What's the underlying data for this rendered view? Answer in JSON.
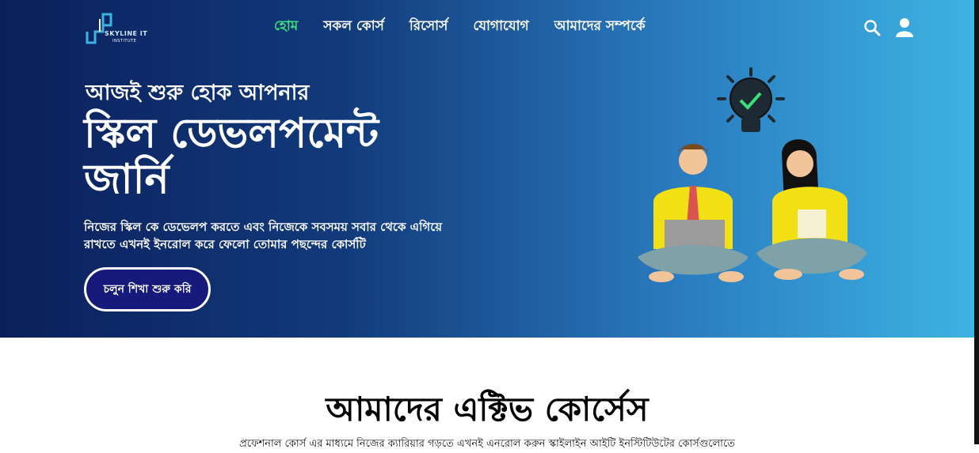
{
  "brand": {
    "logo_text": "SKYLINE IT",
    "logo_sub": "INSTITUTE"
  },
  "nav": {
    "items": [
      {
        "label": "হোম",
        "active": true
      },
      {
        "label": "সকল কোর্স",
        "active": false
      },
      {
        "label": "রিসোর্স",
        "active": false
      },
      {
        "label": "যোগাযোগ",
        "active": false
      },
      {
        "label": "আমাদের সম্পর্কে",
        "active": false
      }
    ],
    "icons": [
      "search-icon",
      "user-icon"
    ]
  },
  "hero": {
    "subtitle": "আজই শুরু হোক আপনার",
    "headline": "স্কিল ডেভলপমেন্ট জার্নি",
    "description": "নিজের স্কিল কে ডেভেলপ করতে এবং নিজেকে সবসময় সবার থেকে এগিয়ে রাখতে এখনই ইনরোল করে ফেলো তোমার পছন্দের কোর্সটি",
    "cta_label": "চলুন শিখা শুরু করি"
  },
  "courses": {
    "title": "আমাদের এক্টিভ কোর্সেস",
    "description": "প্রফেশনাল কোর্স এর মাধ্যমে নিজের ক্যারিয়ার গড়তে এখনই এনরোল করুন স্কাইলাইন আইটি ইনস্টিটিউটের কোর্সগুলোতে"
  },
  "colors": {
    "nav_active": "#3ce07a",
    "cta_bg": "#171a7a",
    "hero_start": "#0b1f5c",
    "hero_end": "#3db3e2"
  }
}
